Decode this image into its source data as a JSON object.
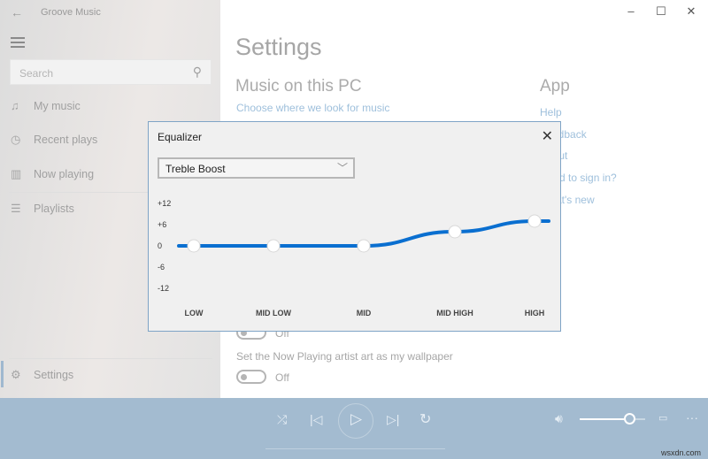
{
  "window": {
    "title": "Groove Music",
    "back_icon": "back-arrow-icon",
    "controls": [
      "minimize",
      "maximize",
      "close"
    ]
  },
  "sidebar": {
    "search_placeholder": "Search",
    "items": [
      {
        "label": "My music",
        "icon": "♫"
      },
      {
        "label": "Recent plays",
        "icon": "◷"
      },
      {
        "label": "Now playing",
        "icon": "▥"
      },
      {
        "label": "Playlists",
        "icon": "☰"
      }
    ],
    "settings_label": "Settings"
  },
  "main": {
    "title": "Settings",
    "music_section": {
      "heading": "Music on this PC",
      "link": "Choose where we look for music"
    },
    "app_section": {
      "heading": "App",
      "links": [
        "Help",
        "Feedback",
        "About",
        "Need to sign in?",
        "What's new"
      ]
    },
    "toggle1": {
      "state": "Off"
    },
    "wallpaper_option": {
      "label": "Set the Now Playing artist art as my wallpaper",
      "state": "Off"
    }
  },
  "equalizer": {
    "title": "Equalizer",
    "preset": "Treble Boost",
    "accent": "#0a6fd0"
  },
  "chart_data": {
    "type": "line",
    "title": "Equalizer",
    "categories": [
      "LOW",
      "MID LOW",
      "MID",
      "MID HIGH",
      "HIGH"
    ],
    "values": [
      0,
      0,
      0,
      4,
      7
    ],
    "yticks": [
      "+12",
      "+6",
      "0",
      "-6",
      "-12"
    ],
    "ylim": [
      -12,
      12
    ],
    "xlabel": "",
    "ylabel": ""
  },
  "player": {
    "watermark": "wsxdn.com"
  }
}
